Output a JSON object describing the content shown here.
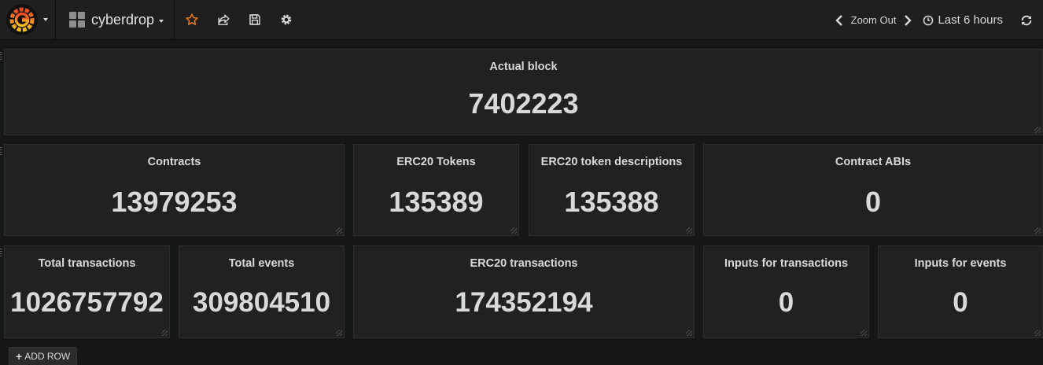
{
  "navbar": {
    "dashboard_title": "cyberdrop",
    "zoom_label": "Zoom Out",
    "time_range": "Last 6 hours"
  },
  "colors": {
    "star": "#eb7b18",
    "background": "#161719",
    "panel": "#212124"
  },
  "rows": [
    {
      "panels": [
        {
          "title": "Actual block",
          "value": "7402223"
        }
      ]
    },
    {
      "panels": [
        {
          "title": "Contracts",
          "value": "13979253"
        },
        {
          "title": "ERC20 Tokens",
          "value": "135389"
        },
        {
          "title": "ERC20 token descriptions",
          "value": "135388"
        },
        {
          "title": "Contract ABIs",
          "value": "0"
        }
      ]
    },
    {
      "panels": [
        {
          "title": "Total transactions",
          "value": "1026757792"
        },
        {
          "title": "Total events",
          "value": "309804510"
        },
        {
          "title": "ERC20 transactions",
          "value": "174352194"
        },
        {
          "title": "Inputs for transactions",
          "value": "0"
        },
        {
          "title": "Inputs for events",
          "value": "0"
        }
      ]
    }
  ],
  "add_row_label": "ADD ROW"
}
